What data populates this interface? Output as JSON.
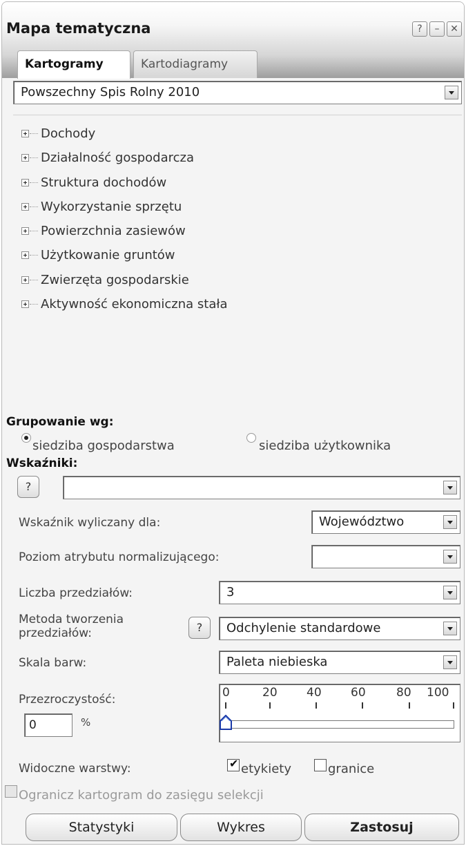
{
  "window": {
    "title": "Mapa tematyczna",
    "buttons": {
      "help": "?",
      "minimize": "–",
      "close": "✕"
    }
  },
  "tabs": [
    {
      "label": "Kartogramy",
      "active": true
    },
    {
      "label": "Kartodiagramy",
      "active": false
    }
  ],
  "dataset_select": {
    "value": "Powszechny Spis Rolny 2010"
  },
  "tree_items": [
    "Dochody",
    "Działalność gospodarcza",
    "Struktura dochodów",
    "Wykorzystanie sprzętu",
    "Powierzchnia zasiewów",
    "Użytkowanie gruntów",
    "Zwierzęta gospodarskie",
    "Aktywność ekonomiczna stała"
  ],
  "grouping": {
    "label": "Grupowanie wg:",
    "options": [
      {
        "label": "siedziba gospodarstwa",
        "selected": true
      },
      {
        "label": "siedziba użytkownika",
        "selected": false
      }
    ]
  },
  "indicators": {
    "label": "Wskaźniki:",
    "help": "?",
    "value": ""
  },
  "indicator_for": {
    "label": "Wskaźnik wyliczany dla:",
    "value": "Województwo"
  },
  "normalizing_level": {
    "label": "Poziom atrybutu normalizującego:",
    "value": ""
  },
  "intervals_count": {
    "label": "Liczba przedziałów:",
    "value": "3"
  },
  "interval_method": {
    "label": "Metoda tworzenia przedziałów:",
    "help": "?",
    "value": "Odchylenie standardowe"
  },
  "color_scale": {
    "label": "Skala barw:",
    "value": "Paleta niebieska"
  },
  "transparency": {
    "label": "Przezroczystość:",
    "value": "0",
    "unit": "%",
    "ticks": [
      "0",
      "20",
      "40",
      "60",
      "80",
      "100"
    ],
    "level": 0
  },
  "visible_layers": {
    "label": "Widoczne warstwy:",
    "labels_option": {
      "label": "etykiety",
      "checked": true
    },
    "borders_option": {
      "label": "granice",
      "checked": false
    }
  },
  "limit_to_selection": {
    "label": "Ogranicz kartogram do zasięgu selekcji",
    "checked": false,
    "disabled": true
  },
  "footer_buttons": {
    "stats": "Statystyki",
    "chart": "Wykres",
    "apply": "Zastosuj"
  }
}
